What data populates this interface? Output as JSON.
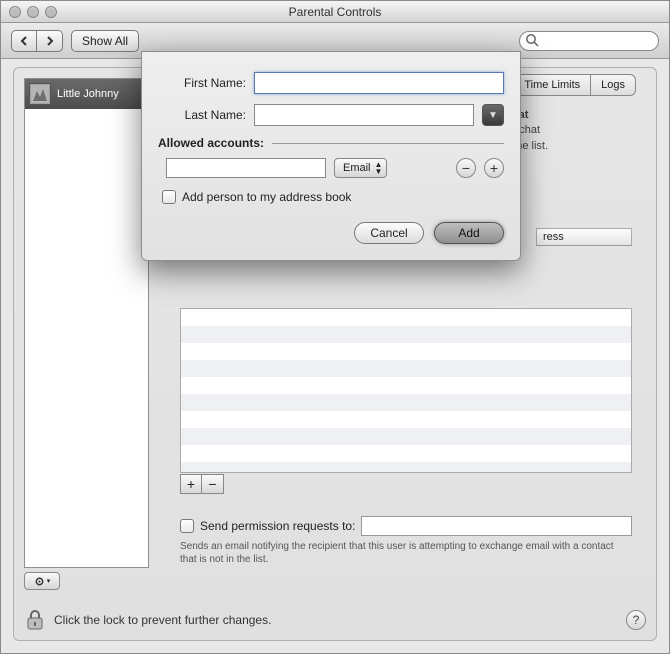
{
  "window": {
    "title": "Parental Controls"
  },
  "toolbar": {
    "show_all": "Show All",
    "search_placeholder": ""
  },
  "tabs": {
    "time_limits": "Time Limits",
    "logs": "Logs"
  },
  "sidebar": {
    "users": [
      {
        "name": "Little Johnny"
      }
    ]
  },
  "right": {
    "chat_heading": "Chat",
    "chat_note_1": "nd chat",
    "chat_note_2": "o the list.",
    "list_header": "ress"
  },
  "perm": {
    "checkbox_label": "Send permission requests to:",
    "field_value": "",
    "note": "Sends an email notifying the recipient that this user is attempting to exchange email with a contact that is not in the list."
  },
  "lock": {
    "text": "Click the lock to prevent further changes."
  },
  "sheet": {
    "first_label": "First Name:",
    "first_value": "",
    "last_label": "Last Name:",
    "last_value": "",
    "section": "Allowed accounts:",
    "account_value": "",
    "account_type": "Email",
    "add_to_book": "Add person to my address book",
    "cancel": "Cancel",
    "add": "Add"
  }
}
